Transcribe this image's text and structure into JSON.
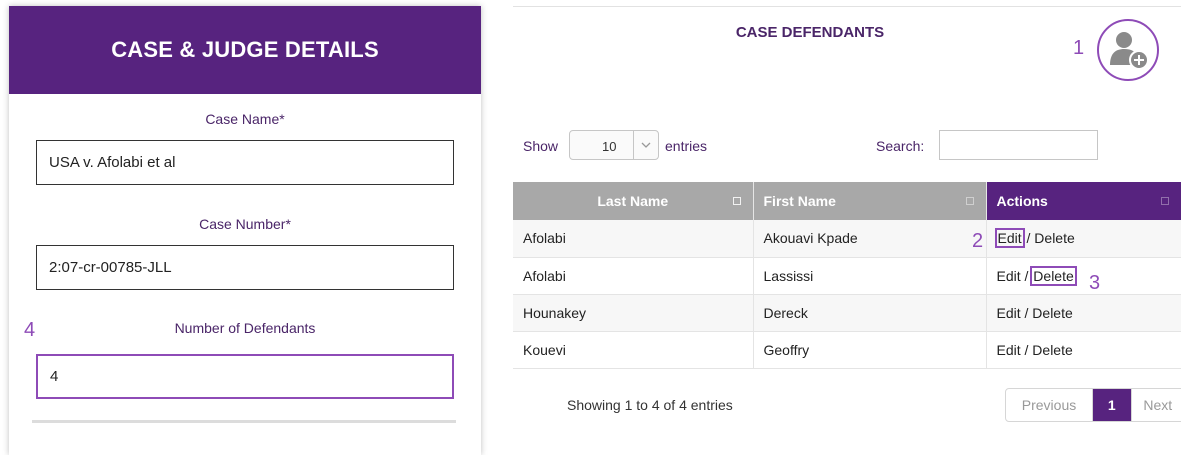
{
  "left_panel": {
    "header_title": "CASE & JUDGE DETAILS",
    "case_name": {
      "label": "Case Name*",
      "value": "USA v. Afolabi et al"
    },
    "case_number": {
      "label": "Case Number*",
      "value": "2:07-cr-00785-JLL"
    },
    "defendants_count": {
      "label": "Number of Defendants",
      "value": "4",
      "callout": "4"
    }
  },
  "right_panel": {
    "title": "CASE DEFENDANTS",
    "add_button_callout": "1",
    "show_label": "Show",
    "entries_length": "10",
    "entries_label": "entries",
    "search_label": "Search:",
    "search_value": "",
    "columns": [
      "Last Name",
      "First Name",
      "Actions"
    ],
    "rows": [
      {
        "last": "Afolabi",
        "first": "Akouavi Kpade",
        "edit": "Edit",
        "sep": " / ",
        "delete": "Delete"
      },
      {
        "last": "Afolabi",
        "first": "Lassissi",
        "edit": "Edit",
        "sep": " / ",
        "delete": "Delete"
      },
      {
        "last": "Hounakey",
        "first": "Dereck",
        "edit": "Edit",
        "sep": " / ",
        "delete": "Delete"
      },
      {
        "last": "Kouevi",
        "first": "Geoffry",
        "edit": "Edit",
        "sep": " / ",
        "delete": "Delete"
      }
    ],
    "edit_callout": "2",
    "delete_callout": "3",
    "info": "Showing 1 to 4 of 4 entries",
    "pagination": {
      "previous": "Previous",
      "current": "1",
      "next": "Next"
    }
  },
  "colors": {
    "brand_purple": "#57237f",
    "highlight": "#8e4bb7",
    "header_gray": "#a8a8a8"
  },
  "icons": {
    "add_user": "add-user-icon",
    "dropdown": "chevron-down-icon",
    "sort": "sort-icon"
  }
}
